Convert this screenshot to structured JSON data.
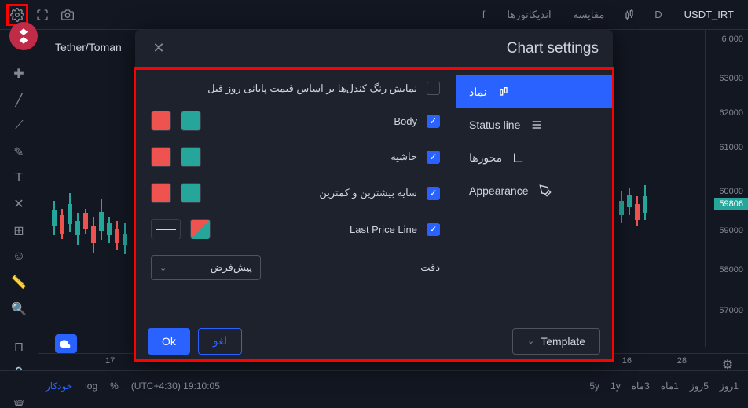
{
  "top": {
    "symbol": "USDT_IRT",
    "interval": "D",
    "compare": "مقایسه",
    "indicators": "اندیکاتورها",
    "fx": "f"
  },
  "pair_label": "Tether/Toman",
  "price_axis": [
    "6 000",
    "63000",
    "62000",
    "61000",
    "60000",
    "59000",
    "58000",
    "57000"
  ],
  "price_current": "59806",
  "time_axis_left": "17",
  "time_axis_right_a": "16",
  "time_axis_right_b": "28",
  "footer": {
    "auto": "خودکار",
    "log": "log",
    "pct": "%",
    "tz": "(UTC+4:30) 19:10:05",
    "ranges": [
      "5y",
      "1y",
      "3ماه",
      "1ماه",
      "5روز",
      "1روز"
    ]
  },
  "modal": {
    "title": "Chart settings",
    "tabs": {
      "symbol": "نماد",
      "status": "Status line",
      "axes": "محورها",
      "appearance": "Appearance"
    },
    "opts": {
      "prev_close": "نمایش رنگ کندل‌ها بر اساس قیمت پایانی روز قبل",
      "body": "Body",
      "border": "حاشیه",
      "wick": "سایه بیشترین و کمترین",
      "last_price": "Last Price Line",
      "precision_label": "دقت",
      "precision_value": "پیش‌فرض"
    },
    "colors": {
      "up": "#26a69a",
      "down": "#ef5350"
    },
    "footer": {
      "ok": "Ok",
      "cancel": "لغو",
      "template": "Template"
    }
  }
}
